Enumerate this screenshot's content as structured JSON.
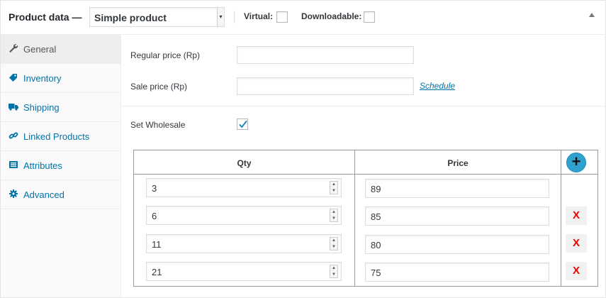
{
  "header": {
    "title": "Product data —",
    "product_type": "Simple product",
    "virtual_label": "Virtual:",
    "downloadable_label": "Downloadable:"
  },
  "sidebar": {
    "items": [
      {
        "label": "General",
        "icon": "wrench-icon",
        "active": true
      },
      {
        "label": "Inventory",
        "icon": "tag-icon",
        "active": false
      },
      {
        "label": "Shipping",
        "icon": "truck-icon",
        "active": false
      },
      {
        "label": "Linked Products",
        "icon": "link-icon",
        "active": false
      },
      {
        "label": "Attributes",
        "icon": "list-icon",
        "active": false
      },
      {
        "label": "Advanced",
        "icon": "gear-icon",
        "active": false
      }
    ]
  },
  "general": {
    "regular_price_label": "Regular price (Rp)",
    "regular_price_value": "",
    "sale_price_label": "Sale price (Rp)",
    "sale_price_value": "",
    "schedule_link": "Schedule",
    "wholesale_label": "Set Wholesale",
    "wholesale_checked": true
  },
  "wholesale_table": {
    "qty_header": "Qty",
    "price_header": "Price",
    "add_label": "+",
    "delete_label": "X",
    "rows": [
      {
        "qty": "3",
        "price": "89"
      },
      {
        "qty": "6",
        "price": "85"
      },
      {
        "qty": "11",
        "price": "80"
      },
      {
        "qty": "21",
        "price": "75"
      }
    ]
  },
  "colors": {
    "link": "#0073aa",
    "add_button": "#2ea2cc",
    "delete": "#e00000"
  }
}
